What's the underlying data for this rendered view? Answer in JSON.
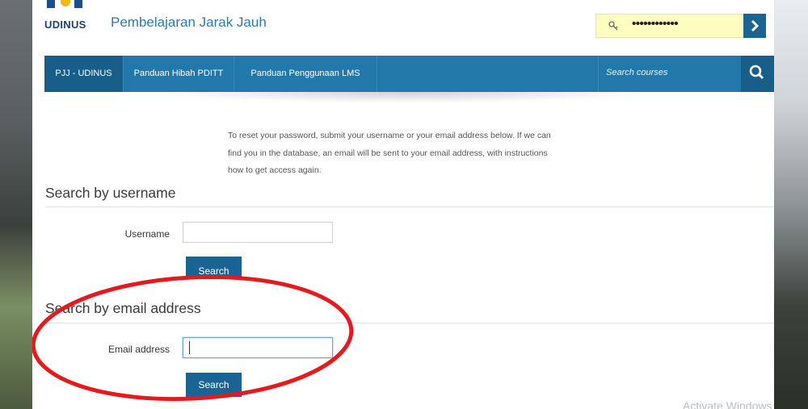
{
  "header": {
    "logo_text": "UDINUS",
    "site_name": "Pembelajaran Jarak Jauh",
    "password_masked": "••••••••••••",
    "login_arrow": "›",
    "key_icon": "key-icon"
  },
  "nav": {
    "items": [
      {
        "label": "PJJ - UDINUS"
      },
      {
        "label": "Panduan Hibah PDITT"
      },
      {
        "label": "Panduan Penggunaan LMS"
      }
    ],
    "search_placeholder": "Search courses",
    "search_icon": "magnifier-icon"
  },
  "content": {
    "intro_lines": [
      "To reset your password, submit your username or your email address below. If we can",
      "find you in the database, an email will be sent to your email address, with instructions",
      "how to get access again."
    ],
    "username_section": {
      "title": "Search by username",
      "label": "Username",
      "value": "",
      "button": "Search"
    },
    "email_section": {
      "title": "Search by email address",
      "label": "Email address",
      "value": "",
      "button": "Search"
    }
  },
  "watermark": "Activate Windows",
  "colors": {
    "brand_blue": "#2179ab",
    "button_blue": "#1a6494",
    "highlight_yellow": "#fefcbf",
    "annotation_red": "#e8191d"
  }
}
